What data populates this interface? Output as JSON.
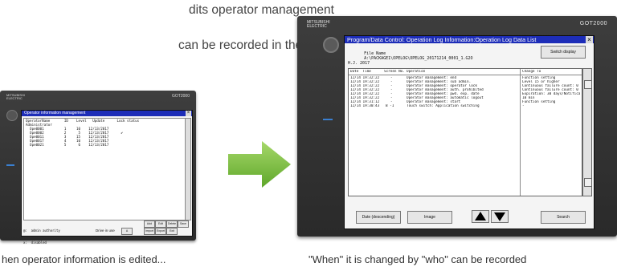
{
  "top_text": {
    "line1": "dits operator management",
    "line2": "can be recorded in the"
  },
  "captions": {
    "left": "hen operator information is edited...",
    "right": "\"When\" it is changed by \"who\" can be recorded"
  },
  "colors": {
    "arrow": "#7cc242",
    "titlebar": "#1d2db8",
    "bezel": "#333333"
  },
  "small_device": {
    "logo_line1": "MITSUBISHI",
    "logo_line2": "ELECTRIC",
    "brand": "GOT2000",
    "title": "Operator information management",
    "close": "×",
    "header": "OperatorName       ID    Level   Update      Lock status",
    "rows": [
      "Administrator",
      "  Ope0001          1     10    12/13/2017",
      "  Ope0002          2      5    12/13/2017      ✔",
      "  Ope0011          3     15    12/13/2017",
      "  Ope0017          4     10    12/13/2017",
      "  Ope0021          5      6    12/13/2017"
    ],
    "footer_line1": "@:  admin authority",
    "footer_line2": "x:  disabled",
    "drive_label": "Drive in use",
    "drive_value": "A",
    "buttons": [
      "Add",
      "Edit",
      "Delete",
      "Save",
      "Import",
      "Export",
      "Exit"
    ]
  },
  "large_device": {
    "logo_line1": "MITSUBISHI",
    "logo_line2": "ELECTRIC",
    "brand": "GOT2000",
    "title": "Program/Data Control: Operation Log Information:Operation Log Data List",
    "close": "×",
    "file_label": "File Name",
    "file_value": "A:\\PACKAGE1\\OPELOG\\OPELOG_20171214_0001_1.G2O",
    "switch_label": "Switch display",
    "date_line": "H.J. 2017",
    "columns": [
      "Date  Time",
      "Screen No.",
      "Operation",
      "Change To"
    ],
    "rows": [
      [
        "12/14 19:32:22",
        "-",
        "Operator management: end",
        "Function setting"
      ],
      [
        "12/14 19:32:22",
        "-",
        "Operator management: sub admin.",
        "Level 15 or higher"
      ],
      [
        "12/14 19:32:22",
        "-",
        "Operator management: operator lock",
        "Continuous failure count: 0"
      ],
      [
        "12/14 19:32:22",
        "-",
        "Operator management: auth. prohibited",
        "Continuous failure count: 0"
      ],
      [
        "12/14 19:32:22",
        "-",
        "Operator management: pwd. exp. date",
        "Expiration: 30 days/Notifica"
      ],
      [
        "12/14 19:32:22",
        "-",
        "Operator management: automatic logout",
        "10 min"
      ],
      [
        "12/14 19:31:12",
        "-",
        "Operator management: start",
        "Function setting"
      ],
      [
        "12/14 19:30:43",
        "B -1",
        "Touch switch: Application switching",
        "-"
      ]
    ],
    "buttons": {
      "date_sort": "Date (descending)",
      "image": "Image",
      "search": "Search"
    }
  }
}
